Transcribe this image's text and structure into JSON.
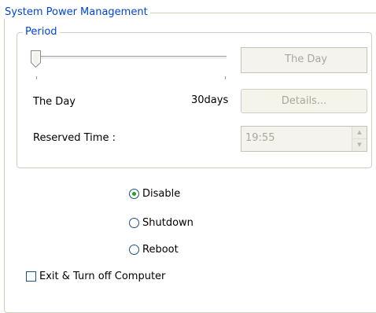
{
  "groups": {
    "power_title": "System Power Management",
    "period_title": "Period"
  },
  "period": {
    "slider_value_display": "The Day",
    "slider_level": 0,
    "min_label": "The Day",
    "max_label": "30days",
    "details_label": "Details...",
    "reserved_label": "Reserved Time :",
    "reserved_value": "19:55"
  },
  "options": {
    "items": [
      {
        "label": "Disable",
        "checked": true
      },
      {
        "label": "Shutdown",
        "checked": false
      },
      {
        "label": "Reboot",
        "checked": false
      }
    ]
  },
  "exit_checkbox": {
    "label": "Exit & Turn off Computer",
    "checked": false
  }
}
